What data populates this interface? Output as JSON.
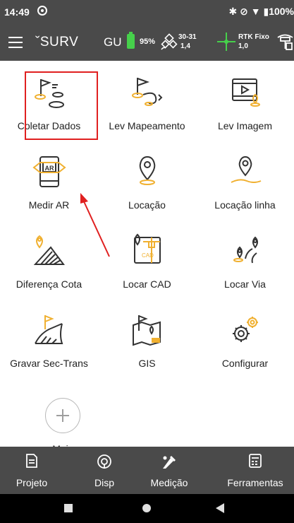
{
  "status_bar": {
    "time": "14:49",
    "right_text": "✱ ⊘ ▼ ▮100%"
  },
  "header": {
    "title": "ˇSURV",
    "gu": "GU",
    "battery_pct": "95%",
    "satellites_top": "30-31",
    "satellites_bottom": "1,4",
    "rtk_status": "RTK Fixo",
    "rtk_value": "1,0",
    "accent_color": "#46d04b"
  },
  "grid": {
    "items": [
      {
        "label": "Coletar Dados",
        "icon": "flag-points-icon"
      },
      {
        "label": "Lev Mapeamento",
        "icon": "flag-path-icon"
      },
      {
        "label": "Lev Imagem",
        "icon": "video-pin-icon"
      },
      {
        "label": "Medir AR",
        "icon": "ar-phone-icon"
      },
      {
        "label": "Locação",
        "icon": "location-pin-icon"
      },
      {
        "label": "Locação linha",
        "icon": "location-line-icon"
      },
      {
        "label": "Diferença Cota",
        "icon": "elevation-diff-icon"
      },
      {
        "label": "Locar CAD",
        "icon": "cad-map-icon"
      },
      {
        "label": "Locar Via",
        "icon": "road-pins-icon"
      },
      {
        "label": "Gravar Sec-Trans",
        "icon": "cross-section-icon"
      },
      {
        "label": "GIS",
        "icon": "gis-map-icon"
      },
      {
        "label": "Configurar",
        "icon": "gears-icon"
      }
    ],
    "more_label": "Mais"
  },
  "bottom_nav": {
    "items": [
      {
        "label": "Projeto",
        "icon": "project-document-icon"
      },
      {
        "label": "Disp",
        "icon": "device-broadcast-icon"
      },
      {
        "label": "Medição",
        "icon": "survey-measure-icon"
      },
      {
        "label": "Ferramentas",
        "icon": "calculator-icon"
      }
    ]
  },
  "colors": {
    "icon_dark": "#333333",
    "icon_gold": "#f0b030",
    "highlight": "#e02020",
    "bar": "#4a4a4a"
  }
}
